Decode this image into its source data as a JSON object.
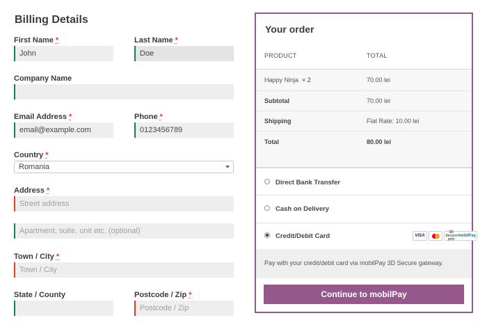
{
  "billing": {
    "title": "Billing Details",
    "required_marker": "*",
    "first_name": {
      "label": "First Name",
      "value": "John",
      "required": true
    },
    "last_name": {
      "label": "Last Name",
      "value": "Doe",
      "required": true
    },
    "company": {
      "label": "Company Name",
      "value": ""
    },
    "email": {
      "label": "Email Address",
      "value": "email@example.com",
      "required": true
    },
    "phone": {
      "label": "Phone",
      "value": "0123456789",
      "required": true
    },
    "country": {
      "label": "Country",
      "value": "Romania",
      "required": true
    },
    "address": {
      "label": "Address",
      "placeholder1": "Street address",
      "placeholder2": "Apartment, suite, unit etc. (optional)",
      "required": true
    },
    "city": {
      "label": "Town / City",
      "placeholder": "Town / City",
      "required": true
    },
    "state": {
      "label": "State / County",
      "value": ""
    },
    "postcode": {
      "label": "Postcode / Zip",
      "placeholder": "Postcode / Zip",
      "required": true
    }
  },
  "order": {
    "title": "Your order",
    "headers": {
      "product": "PRODUCT",
      "total": "TOTAL"
    },
    "item": {
      "name": "Happy Ninja",
      "qty": "× 2",
      "total": "70.00 lei"
    },
    "subtotal": {
      "label": "Subtotal",
      "value": "70.00 lei"
    },
    "shipping": {
      "label": "Shipping",
      "value": "Flat Rate: 10.00 lei"
    },
    "total": {
      "label": "Total",
      "value": "80.00 lei"
    },
    "payment_methods": [
      {
        "label": "Direct Bank Transfer",
        "selected": false
      },
      {
        "label": "Cash on Delivery",
        "selected": false
      },
      {
        "label": "Credit/Debit Card",
        "selected": true
      }
    ],
    "card_logos": {
      "visa": "VISA",
      "mobilpay_line1": "3D Secure prin",
      "mobilpay_line2": "mobilPay"
    },
    "payment_description": "Pay with your credit/debit card via mobilPay 3D Secure gateway.",
    "submit_label": "Continue to mobilPay"
  },
  "colors": {
    "accent": "#96588a",
    "panel_border": "#8e5a8f",
    "valid": "#0f834d",
    "invalid": "#e2401c"
  }
}
